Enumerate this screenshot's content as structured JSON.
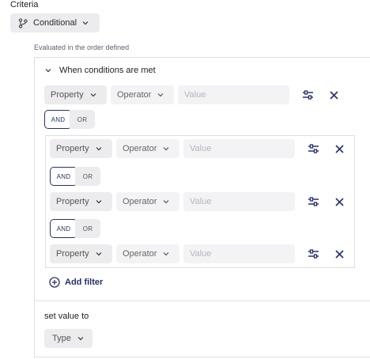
{
  "criteria": {
    "label": "Criteria"
  },
  "mode": {
    "label": "Conditional",
    "icon": "branch-icon"
  },
  "eval_note": "Evaluated in the order defined",
  "conditions": {
    "title": "When conditions are met",
    "top_row": {
      "property": "Property",
      "operator": "Operator",
      "value_placeholder": "Value"
    },
    "top_logic": {
      "and": "AND",
      "or": "OR",
      "selected": "AND"
    },
    "group_rows": [
      {
        "property": "Property",
        "operator": "Operator",
        "value_placeholder": "Value"
      },
      {
        "property": "Property",
        "operator": "Operator",
        "value_placeholder": "Value"
      },
      {
        "property": "Property",
        "operator": "Operator",
        "value_placeholder": "Value"
      }
    ],
    "group_logic": [
      {
        "and": "AND",
        "or": "OR",
        "selected": "AND"
      },
      {
        "and": "AND",
        "or": "OR",
        "selected": "AND"
      }
    ],
    "add_filter": "Add filter"
  },
  "set_value": {
    "label": "set value to",
    "type_label": "Type"
  },
  "colors": {
    "accent": "#27306b",
    "chip_bg": "#ececee",
    "border": "#dcdfe4"
  }
}
